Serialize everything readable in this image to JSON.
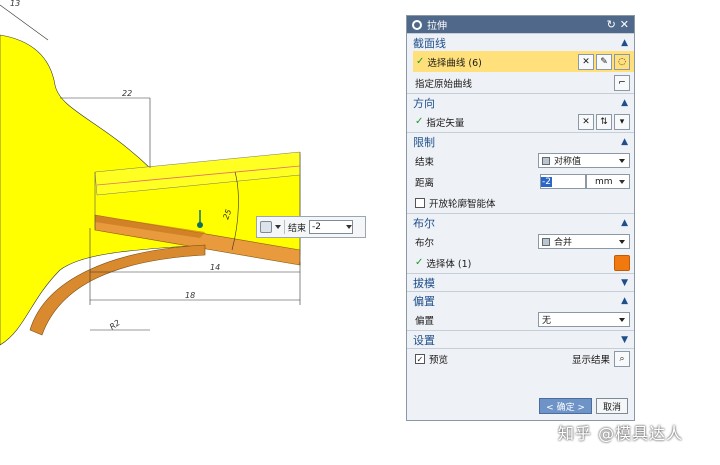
{
  "viewport": {
    "dimensions": [
      "13",
      "22",
      "25",
      "14",
      "18",
      "R2"
    ]
  },
  "float_toolbar": {
    "end_label": "结束",
    "end_value": "-2"
  },
  "dialog": {
    "title": "拉伸",
    "section_curve": {
      "title": "截面线",
      "select_curve": "选择曲线 (6)",
      "specify_origin": "指定原始曲线"
    },
    "section_direction": {
      "title": "方向",
      "specify_vector": "指定矢量"
    },
    "section_limits": {
      "title": "限制",
      "end_label": "结束",
      "end_value": "对称值",
      "distance_label": "距离",
      "distance_value": "-2",
      "distance_unit": "mm",
      "open_profile": "开放轮廓智能体"
    },
    "section_boolean": {
      "title": "布尔",
      "boolean_label": "布尔",
      "boolean_value": "合并",
      "select_body": "选择体 (1)"
    },
    "section_draft": {
      "title": "拔模"
    },
    "section_offset": {
      "title": "偏置",
      "offset_label": "偏置",
      "offset_value": "无"
    },
    "section_settings": {
      "title": "设置"
    },
    "preview_label": "预览",
    "show_result": "显示结果",
    "ok_button": "< 确定 >",
    "cancel_button": "取消"
  },
  "watermark": "知乎 @模具达人"
}
